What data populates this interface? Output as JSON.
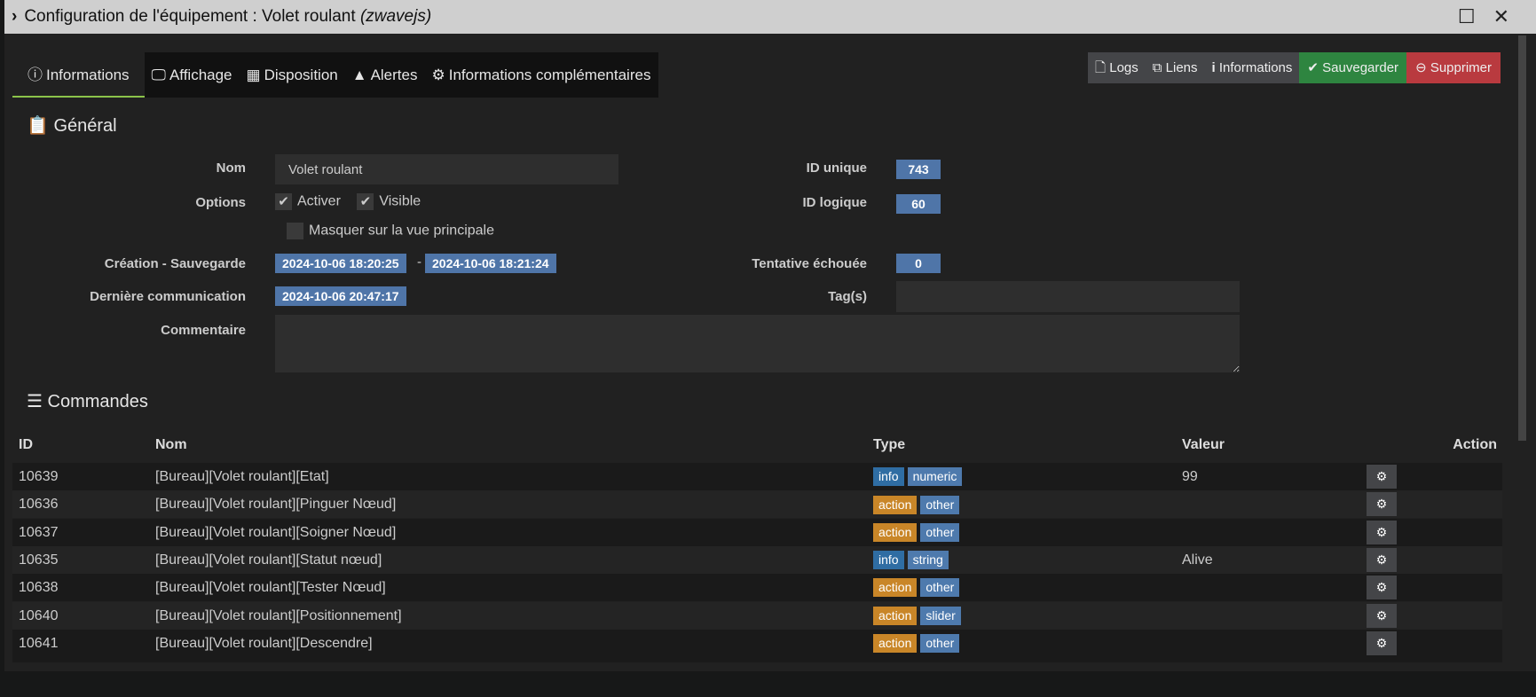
{
  "window": {
    "title": "Configuration de l'équipement : Volet roulant ",
    "plugin": "(zwavejs)"
  },
  "tabs": [
    {
      "label": "Informations",
      "icon": "info-circle-icon"
    },
    {
      "label": "Affichage",
      "icon": "desktop-icon"
    },
    {
      "label": "Disposition",
      "icon": "grid-icon"
    },
    {
      "label": "Alertes",
      "icon": "warning-icon"
    },
    {
      "label": "Informations complémentaires",
      "icon": "cogs-icon"
    }
  ],
  "actions": {
    "logs": "Logs",
    "liens": "Liens",
    "informations": "Informations",
    "save": "Sauvegarder",
    "delete": "Supprimer"
  },
  "general": {
    "title": "Général",
    "nom_label": "Nom",
    "nom_value": "Volet roulant",
    "options_label": "Options",
    "activer": "Activer",
    "visible": "Visible",
    "masquer": "Masquer sur la vue principale",
    "creation_label": "Création - Sauvegarde",
    "creation": "2024-10-06 18:20:25",
    "sep": "-",
    "sauvegarde": "2024-10-06 18:21:24",
    "derniere_label": "Dernière communication",
    "derniere": "2024-10-06 20:47:17",
    "commentaire_label": "Commentaire",
    "id_unique_label": "ID unique",
    "id_unique": "743",
    "id_logique_label": "ID logique",
    "id_logique": "60",
    "tentative_label": "Tentative échouée",
    "tentative": "0",
    "tags_label": "Tag(s)"
  },
  "commandes": {
    "title": "Commandes",
    "headers": {
      "id": "ID",
      "nom": "Nom",
      "type": "Type",
      "valeur": "Valeur",
      "action": "Action"
    },
    "rows": [
      {
        "id": "10639",
        "nom": "[Bureau][Volet roulant][Etat]",
        "type": "info",
        "subtype": "numeric",
        "valeur": "99"
      },
      {
        "id": "10636",
        "nom": "[Bureau][Volet roulant][Pinguer Nœud]",
        "type": "action",
        "subtype": "other",
        "valeur": ""
      },
      {
        "id": "10637",
        "nom": "[Bureau][Volet roulant][Soigner Nœud]",
        "type": "action",
        "subtype": "other",
        "valeur": ""
      },
      {
        "id": "10635",
        "nom": "[Bureau][Volet roulant][Statut nœud]",
        "type": "info",
        "subtype": "string",
        "valeur": "Alive"
      },
      {
        "id": "10638",
        "nom": "[Bureau][Volet roulant][Tester Nœud]",
        "type": "action",
        "subtype": "other",
        "valeur": ""
      },
      {
        "id": "10640",
        "nom": "[Bureau][Volet roulant][Positionnement]",
        "type": "action",
        "subtype": "slider",
        "valeur": ""
      },
      {
        "id": "10641",
        "nom": "[Bureau][Volet roulant][Descendre]",
        "type": "action",
        "subtype": "other",
        "valeur": ""
      }
    ]
  }
}
